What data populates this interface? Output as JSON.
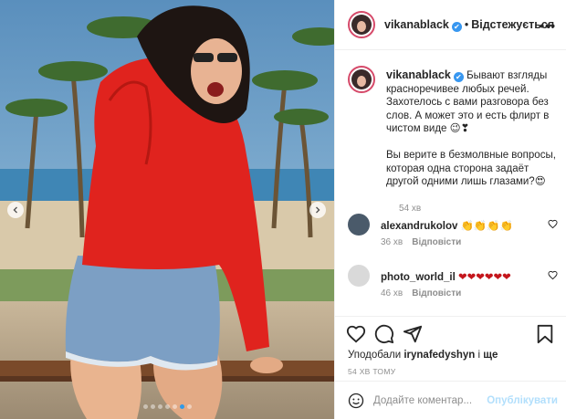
{
  "post": {
    "username": "vikanablack",
    "verified_mark": "✔",
    "separator": "•",
    "follow_status": "Відстежується",
    "more_glyph": "•••"
  },
  "caption": {
    "username": "vikanablack",
    "line1": "Бывают взгляды красноречивее любых речей. Захотелось с вами разговора без слов.⁣ А может это и есть флирт в чистом виде 😉❣",
    "line2": "Вы верите в безмолвные вопросы, которая одна сторона задаёт другой одними лишь глазами?😍",
    "time": "54 хв"
  },
  "comments": [
    {
      "username": "alexandrukolov",
      "text": "👏👏👏👏",
      "time": "36 хв",
      "reply": "Відповісти"
    },
    {
      "username": "photo_world_il",
      "text": "❤❤❤❤❤❤",
      "time": "46 хв",
      "reply": "Відповісти"
    }
  ],
  "likes": {
    "prefix": "Уподобали",
    "user": "irynafedyshyn",
    "suffix": "і",
    "others": "ще"
  },
  "post_time": "54 ХВ ТОМУ",
  "add_comment": {
    "placeholder": "Додайте коментар...",
    "publish_label": "Опублікувати"
  },
  "carousel": {
    "slide_count": 7,
    "active_index": 5
  },
  "icons": {
    "like": "heart-icon",
    "comment": "comment-bubble-icon",
    "share": "paper-plane-icon",
    "save": "bookmark-icon",
    "emoji": "smiley-icon",
    "prev": "chevron-left-icon",
    "next": "chevron-right-icon"
  },
  "colors": {
    "verified": "#3897f0",
    "story_ring": "#d64a6a",
    "publish_disabled": "#b2dffc",
    "active_dot": "#2f9ae8",
    "hoodie": "#e0231e"
  }
}
